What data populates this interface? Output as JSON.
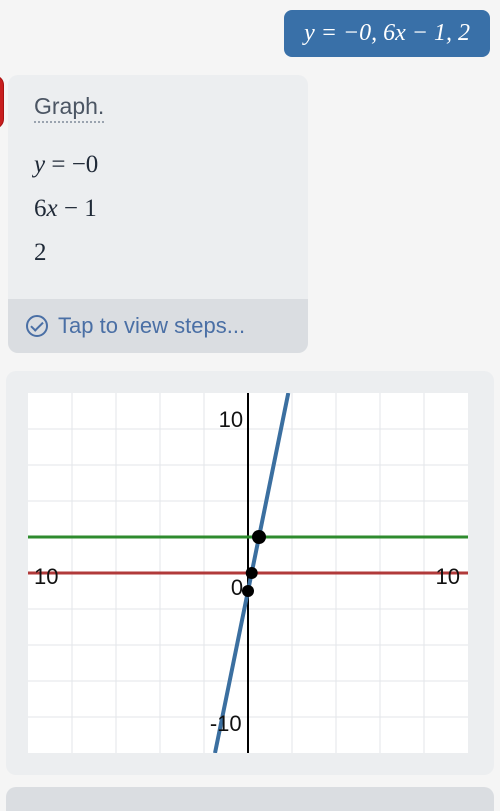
{
  "user_message": "y = −0, 6x − 1, 2",
  "answer": {
    "title": "Graph.",
    "lines": [
      "y = −0",
      "6x − 1",
      "2"
    ],
    "steps_label": "Tap to view steps..."
  },
  "chart_data": {
    "type": "line",
    "xlabel": "",
    "ylabel": "",
    "xlim": [
      -10,
      10
    ],
    "ylim": [
      -10,
      10
    ],
    "grid": true,
    "ticks_shown": {
      "x": [
        -10,
        0,
        10
      ],
      "y": [
        -10,
        10
      ]
    },
    "series": [
      {
        "name": "y = 0",
        "color": "#b13a3a",
        "type": "hline",
        "y": 0
      },
      {
        "name": "y = 2",
        "color": "#2e8b2e",
        "type": "hline",
        "y": 2
      },
      {
        "name": "y = 6x - 1",
        "color": "#3b6fa0",
        "type": "linear",
        "slope": 6,
        "intercept": -1
      }
    ],
    "points": [
      {
        "x": 0.5,
        "y": 2,
        "series": "y=6x-1 ∩ y=2"
      },
      {
        "x": 0.167,
        "y": 0,
        "series": "y=6x-1 ∩ y=0"
      },
      {
        "x": 0,
        "y": -1,
        "series": "y=6x-1 intercept"
      }
    ]
  },
  "axis_text": {
    "top": "10",
    "bottom": "-10",
    "left": "10",
    "right": "10",
    "origin": "0"
  }
}
